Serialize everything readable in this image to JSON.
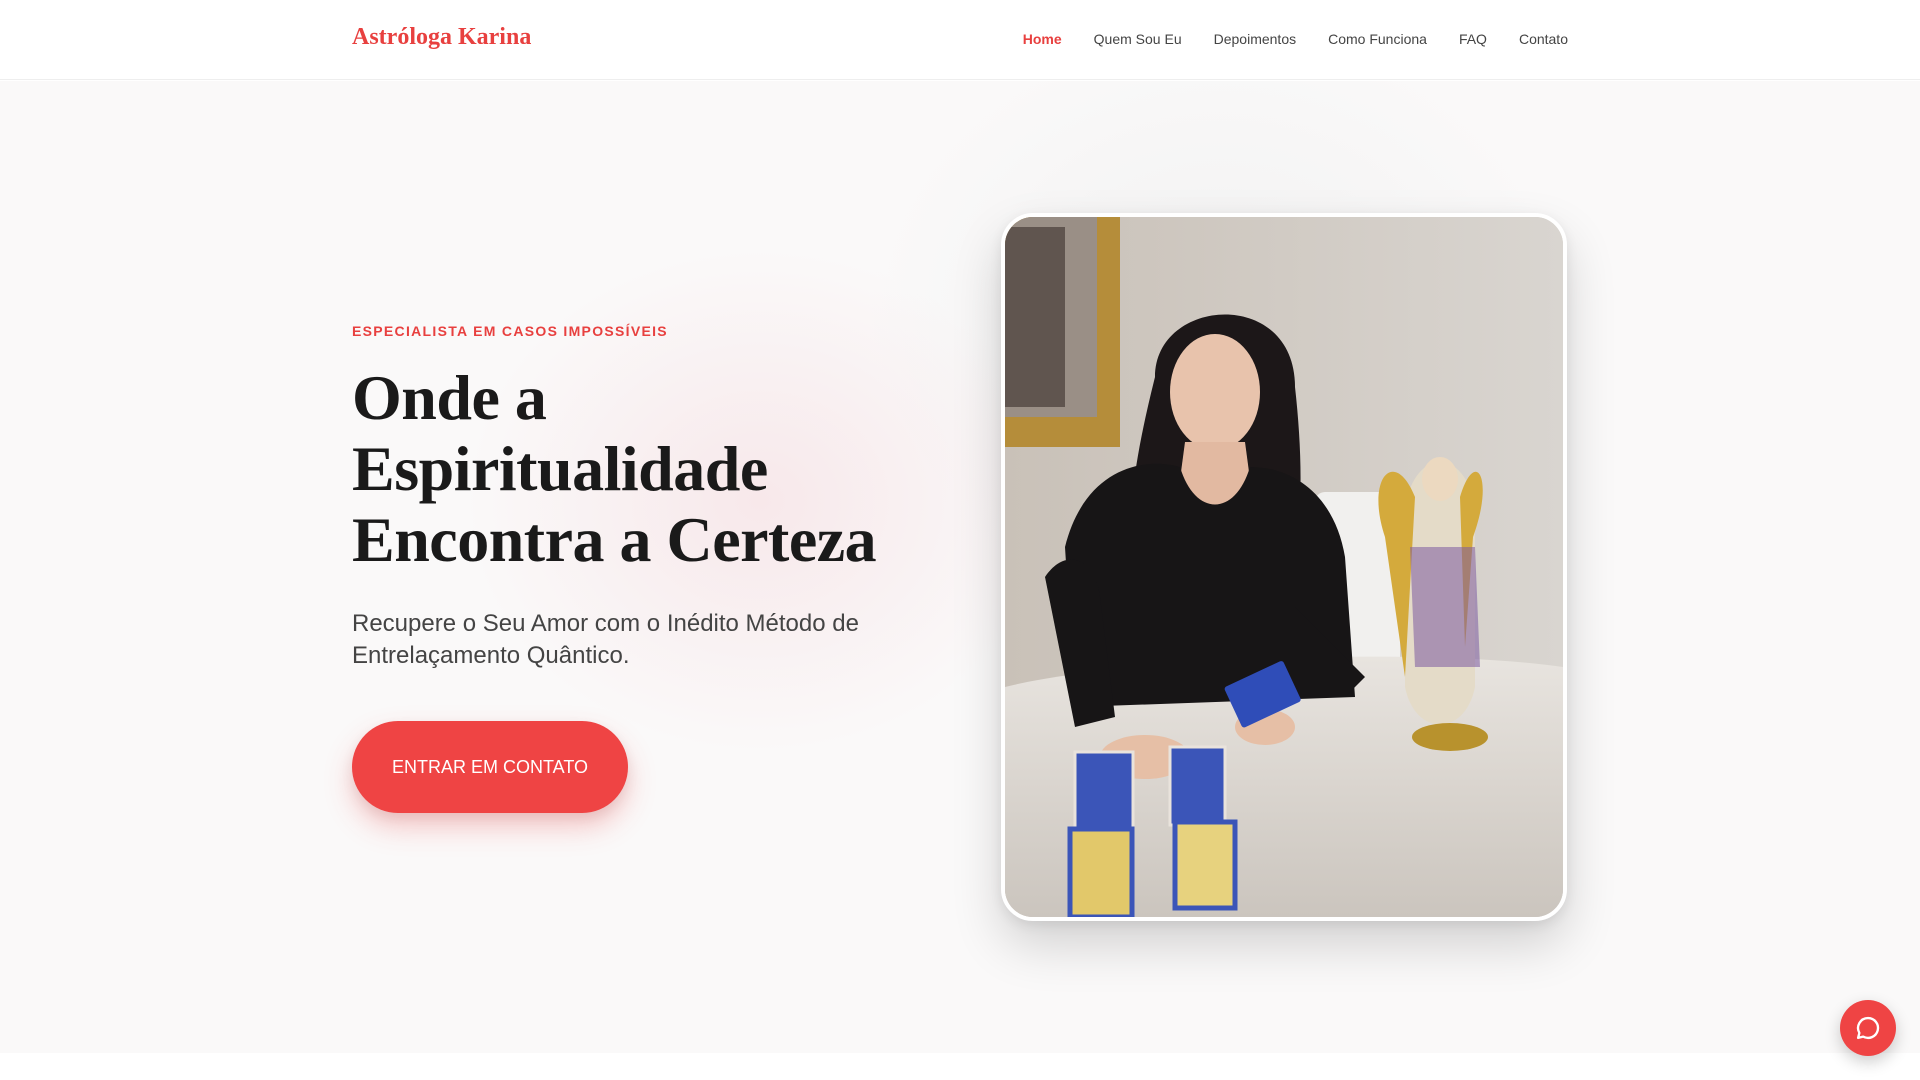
{
  "header": {
    "brand": "Astróloga Karina",
    "nav": [
      {
        "label": "Home",
        "active": true
      },
      {
        "label": "Quem Sou Eu",
        "active": false
      },
      {
        "label": "Depoimentos",
        "active": false
      },
      {
        "label": "Como Funciona",
        "active": false
      },
      {
        "label": "FAQ",
        "active": false
      },
      {
        "label": "Contato",
        "active": false
      }
    ]
  },
  "hero": {
    "eyebrow": "ESPECIALISTA EM CASOS IMPOSSÍVEIS",
    "title": "Onde a Espiritualidade Encontra a Certeza",
    "subtitle": "Recupere o Seu Amor com o Inédito Método de Entrelaçamento Quântico.",
    "cta_label": "ENTRAR EM CONTATO",
    "image_icon": "photo-astrologer-tarot"
  },
  "chat_widget": {
    "icon": "chat-bubble-icon"
  },
  "colors": {
    "accent": "#ef4444",
    "brand_text": "#e8403f",
    "heading": "#1a1a1a",
    "body_text": "#444444",
    "hero_bg": "#faf9f9"
  }
}
